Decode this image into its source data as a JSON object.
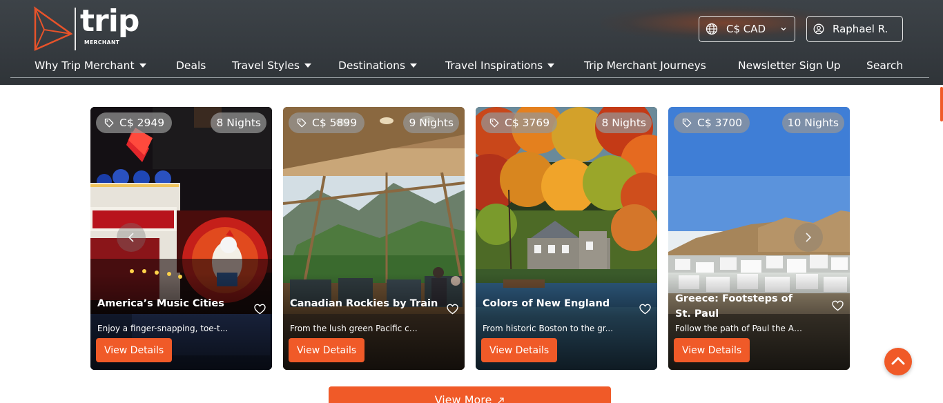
{
  "header": {
    "logo_text": "trip",
    "logo_subtext": "MERCHANT",
    "currency": "C$ CAD",
    "user_name": "Raphael R."
  },
  "nav": {
    "items": [
      {
        "label": "Why Trip Merchant",
        "dropdown": true
      },
      {
        "label": "Deals",
        "dropdown": false
      },
      {
        "label": "Travel Styles",
        "dropdown": true
      },
      {
        "label": "Destinations",
        "dropdown": true
      },
      {
        "label": "Travel Inspirations",
        "dropdown": true
      },
      {
        "label": "Trip Merchant Journeys",
        "dropdown": false
      },
      {
        "label": "Newsletter Sign Up",
        "dropdown": false
      },
      {
        "label": "Search",
        "dropdown": false
      }
    ]
  },
  "cards": [
    {
      "price": "C$ 2949",
      "nights": "8 Nights",
      "title": "America’s Music Cities",
      "desc": "Enjoy a finger-snapping, toe-t...",
      "button": "View Details"
    },
    {
      "price": "C$ 5899",
      "nights": "9 Nights",
      "title": "Canadian Rockies by Train",
      "desc": "From the lush green Pacific co...",
      "button": "View Details"
    },
    {
      "price": "C$ 3769",
      "nights": "8 Nights",
      "title": "Colors of New England",
      "desc": "From historic Boston to the gr...",
      "button": "View Details"
    },
    {
      "price": "C$ 3700",
      "nights": "10 Nights",
      "title": "Greece: Footsteps of St. Paul",
      "desc": "Follow the path of Paul the Ap...",
      "button": "View Details"
    }
  ],
  "view_more": "View More",
  "colors": {
    "accent": "#f05a28",
    "header_bg": "#383d42"
  },
  "icons": [
    "globe-icon",
    "chevron-down-icon",
    "user-icon",
    "tag-icon",
    "heart-icon",
    "chevron-left-icon",
    "chevron-right-icon",
    "arrow-up-icon",
    "external-link-icon"
  ]
}
